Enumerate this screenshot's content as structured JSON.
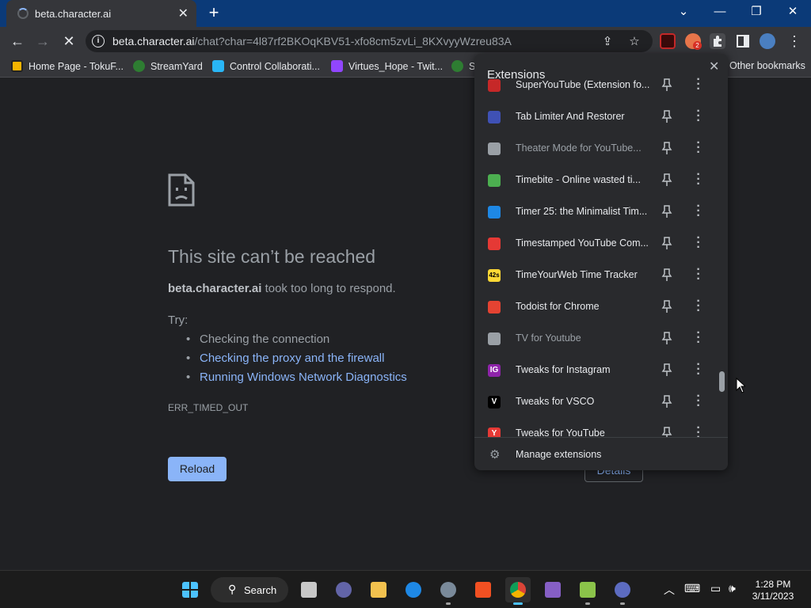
{
  "browser": {
    "tab_title": "beta.character.ai",
    "new_tab": "+",
    "url_host": "beta.character.ai",
    "url_path": "/chat?char=4l87rf2BKOqKBV51-xfo8cm5zvLi_8KXvyyWzreu83A",
    "notification_badge": "2",
    "tab_close": "✕",
    "window_controls": {
      "list": "⌄",
      "minimize": "—",
      "restore": "❐",
      "close": "✕"
    }
  },
  "bookmarks": {
    "items": [
      "Home Page - TokuF...",
      "StreamYard",
      "Control Collaborati...",
      "Virtues_Hope - Twit...",
      "S"
    ],
    "other": "Other bookmarks"
  },
  "error_page": {
    "title": "This site can’t be reached",
    "host": "beta.character.ai",
    "message": " took too long to respond.",
    "try_label": "Try:",
    "suggestions": [
      "Checking the connection",
      "Checking the proxy and the firewall",
      "Running Windows Network Diagnostics"
    ],
    "error_code": "ERR_TIMED_OUT",
    "reload_label": "Reload",
    "details_label": "Details"
  },
  "extensions_popup": {
    "title": "Extensions",
    "close": "✕",
    "items": [
      {
        "name": "SuperYouTube (Extension fo...",
        "icon": "superyoutube-icon",
        "color": "#c62828"
      },
      {
        "name": "Tab Limiter And Restorer",
        "icon": "tab-limiter-icon",
        "color": "#3f51b5"
      },
      {
        "name": "Theater Mode for YouTube...",
        "icon": "external-link-icon",
        "color": "#9aa0a6"
      },
      {
        "name": "Timebite - Online wasted ti...",
        "icon": "timebite-icon",
        "color": "#4caf50"
      },
      {
        "name": "Timer 25: the Minimalist Tim...",
        "icon": "hourglass-icon",
        "color": "#1e88e5"
      },
      {
        "name": "Timestamped YouTube Com...",
        "icon": "timestamped-icon",
        "color": "#e53935"
      },
      {
        "name": "TimeYourWeb Time Tracker",
        "icon": "timeyourweb-icon",
        "color": "#fdd835"
      },
      {
        "name": "Todoist for Chrome",
        "icon": "todoist-icon",
        "color": "#e44332"
      },
      {
        "name": "TV for Youtube",
        "icon": "tv-icon",
        "color": "#9aa0a6"
      },
      {
        "name": "Tweaks for Instagram",
        "icon": "instagram-tweaks-icon",
        "color": "#8e24aa"
      },
      {
        "name": "Tweaks for VSCO",
        "icon": "vsco-tweaks-icon",
        "color": "#000000"
      },
      {
        "name": "Tweaks for YouTube",
        "icon": "youtube-tweaks-icon",
        "color": "#e53935"
      }
    ],
    "item_glyphs": [
      "",
      "",
      "",
      "",
      "",
      "",
      "42s",
      "",
      "",
      "IG",
      "V",
      "Y"
    ],
    "manage_label": "Manage extensions"
  },
  "taskbar": {
    "search_label": "Search",
    "time": "1:28 PM",
    "date": "3/11/2023"
  }
}
